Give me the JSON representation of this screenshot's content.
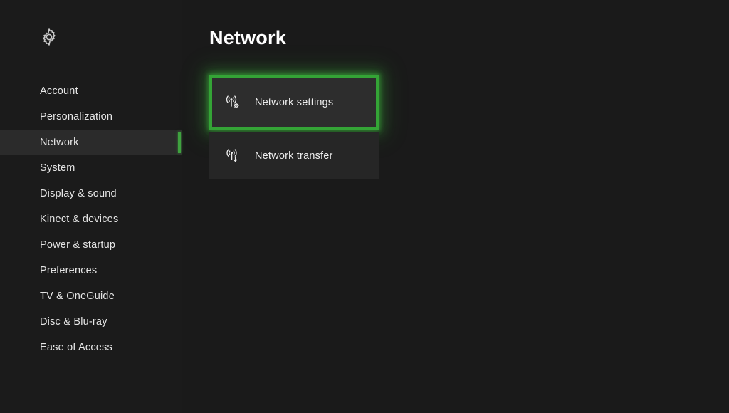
{
  "window": {
    "background_color": "#1a1a1a",
    "accent_color": "#34a436"
  },
  "sidebar": {
    "settings_icon": "gear-icon",
    "items": [
      {
        "label": "Account",
        "selected": false
      },
      {
        "label": "Personalization",
        "selected": false
      },
      {
        "label": "Network",
        "selected": true
      },
      {
        "label": "System",
        "selected": false
      },
      {
        "label": "Display & sound",
        "selected": false
      },
      {
        "label": "Kinect & devices",
        "selected": false
      },
      {
        "label": "Power & startup",
        "selected": false
      },
      {
        "label": "Preferences",
        "selected": false
      },
      {
        "label": "TV & OneGuide",
        "selected": false
      },
      {
        "label": "Disc & Blu-ray",
        "selected": false
      },
      {
        "label": "Ease of Access",
        "selected": false
      }
    ]
  },
  "main": {
    "title": "Network",
    "tiles": [
      {
        "label": "Network settings",
        "icon": "wireless-tower-gear-icon",
        "focused": true
      },
      {
        "label": "Network transfer",
        "icon": "wireless-tower-download-icon",
        "focused": false
      }
    ]
  }
}
